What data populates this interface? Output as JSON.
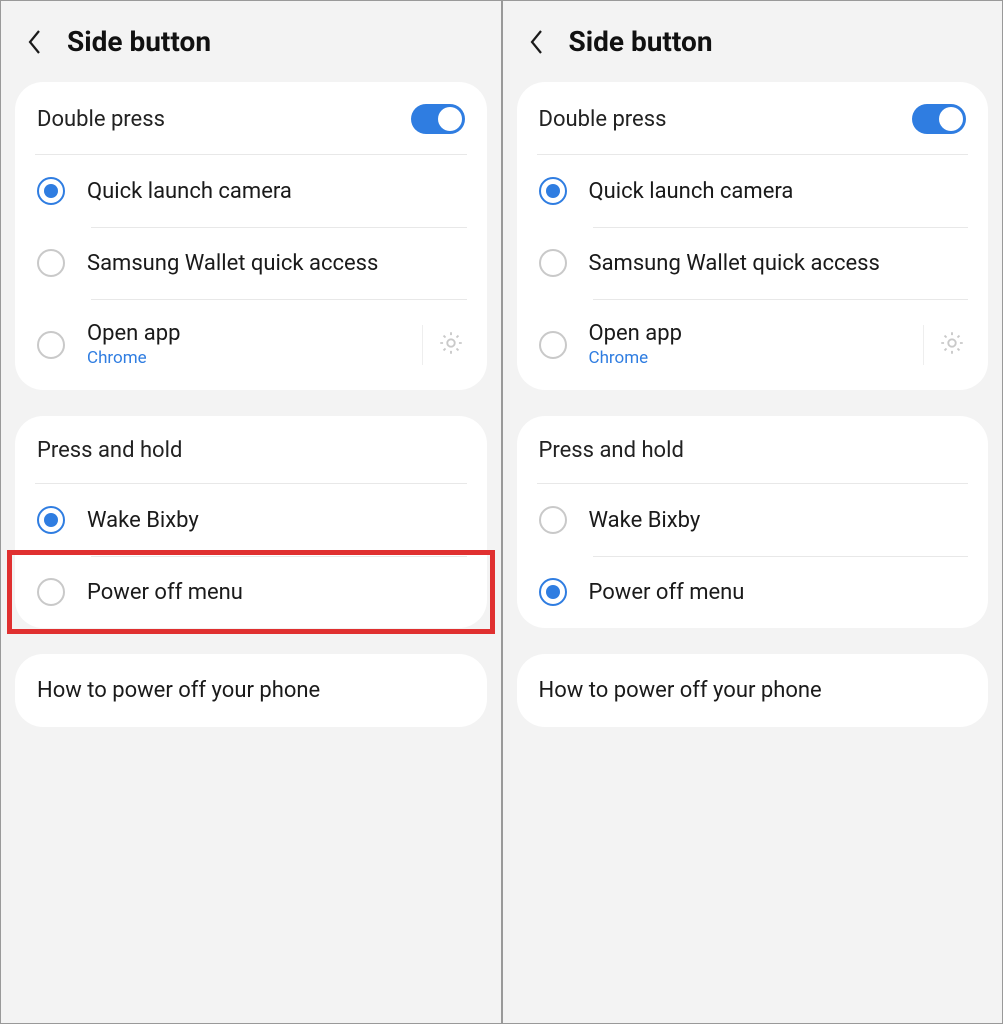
{
  "panes": [
    {
      "title": "Side button",
      "double_press": {
        "label": "Double press",
        "toggle_on": true,
        "options": [
          {
            "label": "Quick launch camera",
            "selected": true
          },
          {
            "label": "Samsung Wallet quick access",
            "selected": false
          },
          {
            "label": "Open app",
            "sub": "Chrome",
            "selected": false,
            "has_gear": true
          }
        ]
      },
      "press_hold": {
        "label": "Press and hold",
        "options": [
          {
            "label": "Wake Bixby",
            "selected": true
          },
          {
            "label": "Power off menu",
            "selected": false,
            "highlighted": true
          }
        ]
      },
      "link": {
        "label": "How to power off your phone"
      }
    },
    {
      "title": "Side button",
      "double_press": {
        "label": "Double press",
        "toggle_on": true,
        "options": [
          {
            "label": "Quick launch camera",
            "selected": true
          },
          {
            "label": "Samsung Wallet quick access",
            "selected": false
          },
          {
            "label": "Open app",
            "sub": "Chrome",
            "selected": false,
            "has_gear": true
          }
        ]
      },
      "press_hold": {
        "label": "Press and hold",
        "options": [
          {
            "label": "Wake Bixby",
            "selected": false
          },
          {
            "label": "Power off menu",
            "selected": true
          }
        ]
      },
      "link": {
        "label": "How to power off your phone"
      }
    }
  ]
}
